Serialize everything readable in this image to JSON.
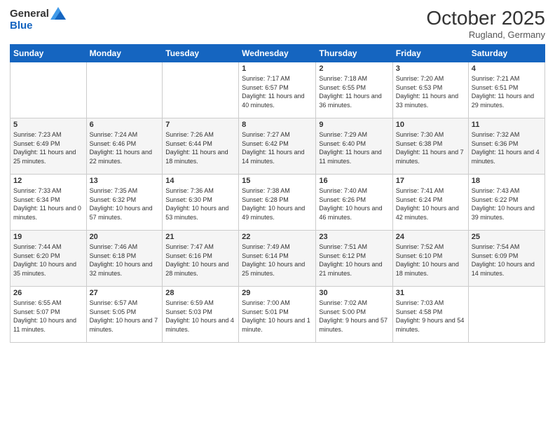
{
  "header": {
    "logo_general": "General",
    "logo_blue": "Blue",
    "month": "October 2025",
    "location": "Rugland, Germany"
  },
  "weekdays": [
    "Sunday",
    "Monday",
    "Tuesday",
    "Wednesday",
    "Thursday",
    "Friday",
    "Saturday"
  ],
  "weeks": [
    [
      {
        "day": "",
        "sunrise": "",
        "sunset": "",
        "daylight": ""
      },
      {
        "day": "",
        "sunrise": "",
        "sunset": "",
        "daylight": ""
      },
      {
        "day": "",
        "sunrise": "",
        "sunset": "",
        "daylight": ""
      },
      {
        "day": "1",
        "sunrise": "Sunrise: 7:17 AM",
        "sunset": "Sunset: 6:57 PM",
        "daylight": "Daylight: 11 hours and 40 minutes."
      },
      {
        "day": "2",
        "sunrise": "Sunrise: 7:18 AM",
        "sunset": "Sunset: 6:55 PM",
        "daylight": "Daylight: 11 hours and 36 minutes."
      },
      {
        "day": "3",
        "sunrise": "Sunrise: 7:20 AM",
        "sunset": "Sunset: 6:53 PM",
        "daylight": "Daylight: 11 hours and 33 minutes."
      },
      {
        "day": "4",
        "sunrise": "Sunrise: 7:21 AM",
        "sunset": "Sunset: 6:51 PM",
        "daylight": "Daylight: 11 hours and 29 minutes."
      }
    ],
    [
      {
        "day": "5",
        "sunrise": "Sunrise: 7:23 AM",
        "sunset": "Sunset: 6:49 PM",
        "daylight": "Daylight: 11 hours and 25 minutes."
      },
      {
        "day": "6",
        "sunrise": "Sunrise: 7:24 AM",
        "sunset": "Sunset: 6:46 PM",
        "daylight": "Daylight: 11 hours and 22 minutes."
      },
      {
        "day": "7",
        "sunrise": "Sunrise: 7:26 AM",
        "sunset": "Sunset: 6:44 PM",
        "daylight": "Daylight: 11 hours and 18 minutes."
      },
      {
        "day": "8",
        "sunrise": "Sunrise: 7:27 AM",
        "sunset": "Sunset: 6:42 PM",
        "daylight": "Daylight: 11 hours and 14 minutes."
      },
      {
        "day": "9",
        "sunrise": "Sunrise: 7:29 AM",
        "sunset": "Sunset: 6:40 PM",
        "daylight": "Daylight: 11 hours and 11 minutes."
      },
      {
        "day": "10",
        "sunrise": "Sunrise: 7:30 AM",
        "sunset": "Sunset: 6:38 PM",
        "daylight": "Daylight: 11 hours and 7 minutes."
      },
      {
        "day": "11",
        "sunrise": "Sunrise: 7:32 AM",
        "sunset": "Sunset: 6:36 PM",
        "daylight": "Daylight: 11 hours and 4 minutes."
      }
    ],
    [
      {
        "day": "12",
        "sunrise": "Sunrise: 7:33 AM",
        "sunset": "Sunset: 6:34 PM",
        "daylight": "Daylight: 11 hours and 0 minutes."
      },
      {
        "day": "13",
        "sunrise": "Sunrise: 7:35 AM",
        "sunset": "Sunset: 6:32 PM",
        "daylight": "Daylight: 10 hours and 57 minutes."
      },
      {
        "day": "14",
        "sunrise": "Sunrise: 7:36 AM",
        "sunset": "Sunset: 6:30 PM",
        "daylight": "Daylight: 10 hours and 53 minutes."
      },
      {
        "day": "15",
        "sunrise": "Sunrise: 7:38 AM",
        "sunset": "Sunset: 6:28 PM",
        "daylight": "Daylight: 10 hours and 49 minutes."
      },
      {
        "day": "16",
        "sunrise": "Sunrise: 7:40 AM",
        "sunset": "Sunset: 6:26 PM",
        "daylight": "Daylight: 10 hours and 46 minutes."
      },
      {
        "day": "17",
        "sunrise": "Sunrise: 7:41 AM",
        "sunset": "Sunset: 6:24 PM",
        "daylight": "Daylight: 10 hours and 42 minutes."
      },
      {
        "day": "18",
        "sunrise": "Sunrise: 7:43 AM",
        "sunset": "Sunset: 6:22 PM",
        "daylight": "Daylight: 10 hours and 39 minutes."
      }
    ],
    [
      {
        "day": "19",
        "sunrise": "Sunrise: 7:44 AM",
        "sunset": "Sunset: 6:20 PM",
        "daylight": "Daylight: 10 hours and 35 minutes."
      },
      {
        "day": "20",
        "sunrise": "Sunrise: 7:46 AM",
        "sunset": "Sunset: 6:18 PM",
        "daylight": "Daylight: 10 hours and 32 minutes."
      },
      {
        "day": "21",
        "sunrise": "Sunrise: 7:47 AM",
        "sunset": "Sunset: 6:16 PM",
        "daylight": "Daylight: 10 hours and 28 minutes."
      },
      {
        "day": "22",
        "sunrise": "Sunrise: 7:49 AM",
        "sunset": "Sunset: 6:14 PM",
        "daylight": "Daylight: 10 hours and 25 minutes."
      },
      {
        "day": "23",
        "sunrise": "Sunrise: 7:51 AM",
        "sunset": "Sunset: 6:12 PM",
        "daylight": "Daylight: 10 hours and 21 minutes."
      },
      {
        "day": "24",
        "sunrise": "Sunrise: 7:52 AM",
        "sunset": "Sunset: 6:10 PM",
        "daylight": "Daylight: 10 hours and 18 minutes."
      },
      {
        "day": "25",
        "sunrise": "Sunrise: 7:54 AM",
        "sunset": "Sunset: 6:09 PM",
        "daylight": "Daylight: 10 hours and 14 minutes."
      }
    ],
    [
      {
        "day": "26",
        "sunrise": "Sunrise: 6:55 AM",
        "sunset": "Sunset: 5:07 PM",
        "daylight": "Daylight: 10 hours and 11 minutes."
      },
      {
        "day": "27",
        "sunrise": "Sunrise: 6:57 AM",
        "sunset": "Sunset: 5:05 PM",
        "daylight": "Daylight: 10 hours and 7 minutes."
      },
      {
        "day": "28",
        "sunrise": "Sunrise: 6:59 AM",
        "sunset": "Sunset: 5:03 PM",
        "daylight": "Daylight: 10 hours and 4 minutes."
      },
      {
        "day": "29",
        "sunrise": "Sunrise: 7:00 AM",
        "sunset": "Sunset: 5:01 PM",
        "daylight": "Daylight: 10 hours and 1 minute."
      },
      {
        "day": "30",
        "sunrise": "Sunrise: 7:02 AM",
        "sunset": "Sunset: 5:00 PM",
        "daylight": "Daylight: 9 hours and 57 minutes."
      },
      {
        "day": "31",
        "sunrise": "Sunrise: 7:03 AM",
        "sunset": "Sunset: 4:58 PM",
        "daylight": "Daylight: 9 hours and 54 minutes."
      },
      {
        "day": "",
        "sunrise": "",
        "sunset": "",
        "daylight": ""
      }
    ]
  ]
}
